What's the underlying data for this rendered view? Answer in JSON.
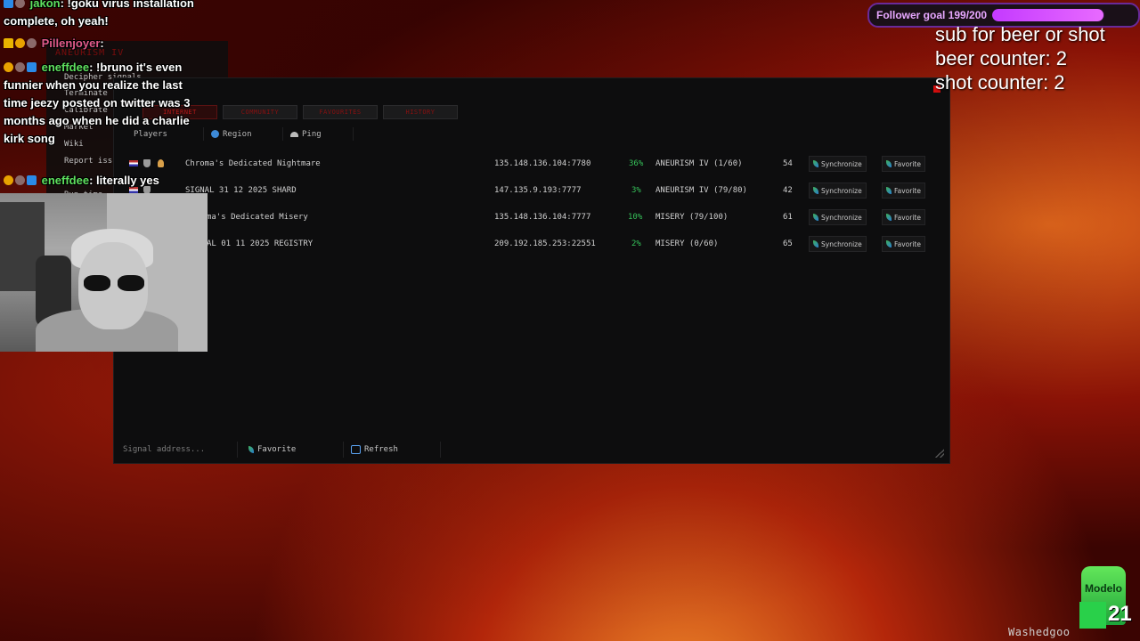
{
  "chat": {
    "messages": [
      {
        "user": "jakon",
        "text": "!goku virus installation complete, oh yeah!"
      },
      {
        "user": "Pillenjoyer",
        "text": ""
      },
      {
        "user": "eneffdee",
        "text": "!bruno it's even funnier when you realize the last time jeezy posted on twitter was 3 months ago when he did a charlie kirk song"
      },
      {
        "user": "eneffdee",
        "text": "literally yes"
      }
    ]
  },
  "game_menu": {
    "title": "ANEURISM IV",
    "items": [
      "Decipher signals",
      "Terminate",
      "Calibrate",
      "Market",
      "Wiki",
      "Report iss",
      "Run time"
    ]
  },
  "server_browser": {
    "tabs": [
      "INTERNET",
      "COMMUNITY",
      "FAVOURITES",
      "HISTORY"
    ],
    "columns": [
      "Players",
      "Region",
      "Ping"
    ],
    "rows": [
      {
        "name": "Chroma's Dedicated Nightmare",
        "address": "135.148.136.104:7780",
        "load": "36%",
        "map": "ANEURISM IV (1/60)",
        "ping": "54",
        "sync": "Synchronize",
        "fav": "Favorite"
      },
      {
        "name": "SIGNAL 31 12 2025 SHARD",
        "address": "147.135.9.193:7777",
        "load": "3%",
        "map": "ANEURISM IV (79/80)",
        "ping": "42",
        "sync": "Synchronize",
        "fav": "Favorite"
      },
      {
        "name": "ma's Dedicated Misery",
        "address": "135.148.136.104:7777",
        "load": "10%",
        "map": "MISERY (79/100)",
        "ping": "61",
        "sync": "Synchronize",
        "fav": "Favorite"
      },
      {
        "name": "AL 01 11 2025 REGISTRY",
        "address": "209.192.185.253:22551",
        "load": "2%",
        "map": "MISERY (0/60)",
        "ping": "65",
        "sync": "Synchronize",
        "fav": "Favorite"
      }
    ],
    "bottom": {
      "address_placeholder": "Signal address...",
      "favorite": "Favorite",
      "refresh": "Refresh"
    }
  },
  "overlay": {
    "goal_text": "Follower goal 199/200",
    "goal_progress": 0.995,
    "line1": "sub for beer or shot",
    "line2": "beer counter: 2",
    "line3": "shot counter: 2",
    "modelo_label": "Modelo",
    "kick_count": "21",
    "watermark": "Washedgoo"
  },
  "colors": {
    "accent_red": "#b01818",
    "ping_green": "#36c25a",
    "goal_purple": "#c43aff"
  }
}
